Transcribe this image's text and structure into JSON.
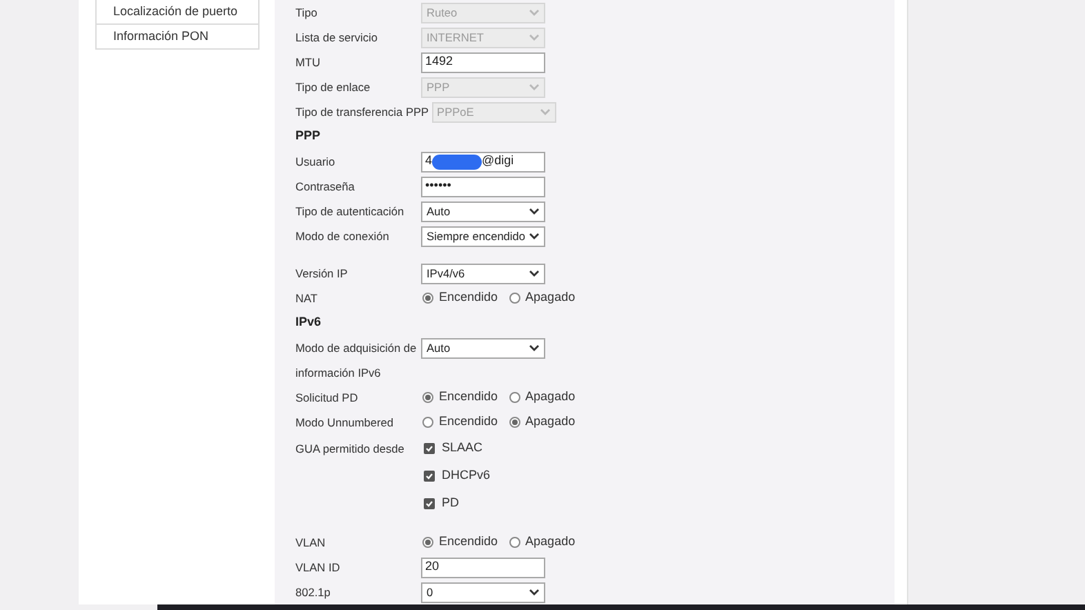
{
  "sidebar": {
    "items": [
      {
        "label": "Localización de puerto"
      },
      {
        "label": "Información PON"
      }
    ]
  },
  "rows": [
    {
      "kind": "select",
      "label": "Tipo",
      "value": "Ruteo",
      "disabled": true
    },
    {
      "kind": "select",
      "label": "Lista de servicio",
      "value": "INTERNET",
      "disabled": true
    },
    {
      "kind": "input",
      "label": "MTU",
      "value": "1492"
    },
    {
      "kind": "select",
      "label": "Tipo de enlace",
      "value": "PPP",
      "disabled": true
    },
    {
      "kind": "select",
      "label": "Tipo de transferencia PPP",
      "value": "PPPoE",
      "disabled": true
    },
    {
      "kind": "heading",
      "label": "PPP"
    },
    {
      "kind": "redacted",
      "label": "Usuario",
      "value": "4",
      "suffix": "@digi"
    },
    {
      "kind": "input",
      "label": "Contraseña",
      "value": "••••••"
    },
    {
      "kind": "select",
      "label": "Tipo de autenticación",
      "value": "Auto",
      "disabled": false
    },
    {
      "kind": "select",
      "label": "Modo de conexión",
      "value": "Siempre encendido",
      "disabled": false
    },
    {
      "kind": "spacer"
    },
    {
      "kind": "select",
      "label": "Versión IP",
      "value": "IPv4/v6",
      "disabled": false
    },
    {
      "kind": "radio",
      "label": "NAT",
      "options": [
        {
          "label": "Encendido",
          "selected": true
        },
        {
          "label": "Apagado",
          "selected": false
        }
      ]
    },
    {
      "kind": "heading",
      "label": "IPv6"
    },
    {
      "kind": "select",
      "label": "Modo de adquisición de",
      "value": "Auto",
      "disabled": false
    },
    {
      "kind": "text",
      "label": "información IPv6"
    },
    {
      "kind": "radio",
      "label": "Solicitud PD",
      "options": [
        {
          "label": "Encendido",
          "selected": true
        },
        {
          "label": "Apagado",
          "selected": false
        }
      ]
    },
    {
      "kind": "radio",
      "label": "Modo Unnumbered",
      "options": [
        {
          "label": "Encendido",
          "selected": false
        },
        {
          "label": "Apagado",
          "selected": true
        }
      ]
    },
    {
      "kind": "checkbox",
      "label": "GUA permitido desde",
      "option": "SLAAC",
      "checked": true
    },
    {
      "kind": "checkbox",
      "option": "DHCPv6",
      "checked": true
    },
    {
      "kind": "checkbox",
      "option": "PD",
      "checked": true
    },
    {
      "kind": "spacer"
    },
    {
      "kind": "radio",
      "label": "VLAN",
      "options": [
        {
          "label": "Encendido",
          "selected": true
        },
        {
          "label": "Apagado",
          "selected": false
        }
      ]
    },
    {
      "kind": "input",
      "label": "VLAN ID",
      "value": "20"
    },
    {
      "kind": "select",
      "label": "802.1p",
      "value": "0",
      "disabled": false
    }
  ]
}
